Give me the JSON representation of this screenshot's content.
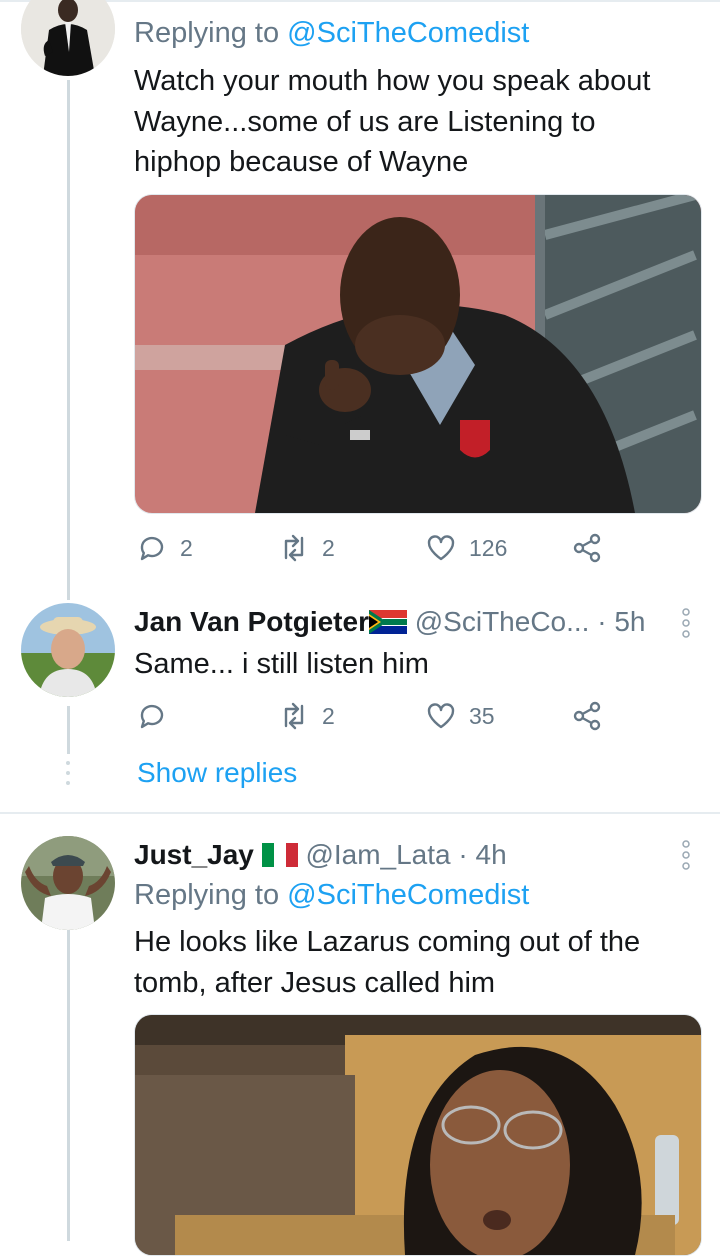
{
  "tweet1": {
    "replying_prefix": "Replying to",
    "replying_handle": "@SciTheComedist",
    "text_line1": "Watch your mouth how you speak about",
    "text_line2": "Wayne...some of us are Listening to",
    "text_line3": "hiphop because of Wayne",
    "replies": "2",
    "retweets": "2",
    "likes": "126"
  },
  "tweet2": {
    "name": "Jan Van Potgieter",
    "flag": "south-africa-flag",
    "handle": "@SciTheCo...",
    "time": "· 5h",
    "text": "Same... i still listen him",
    "retweets": "2",
    "likes": "35",
    "show_replies": "Show replies"
  },
  "tweet3": {
    "name": "Just_Jay",
    "flag": "italy-flag",
    "handle": "@Iam_Lata",
    "time": "· 4h",
    "replying_prefix": "Replying to",
    "replying_handle": "@SciTheComedist",
    "text_line1": "He looks like Lazarus coming out of the",
    "text_line2": "tomb, after Jesus called him"
  },
  "colors": {
    "link": "#1da1f2",
    "muted": "#657786",
    "text": "#14171a",
    "thread_line": "#cfd9de"
  },
  "icons": [
    "reply-icon",
    "retweet-icon",
    "like-icon",
    "share-icon",
    "more-icon"
  ]
}
